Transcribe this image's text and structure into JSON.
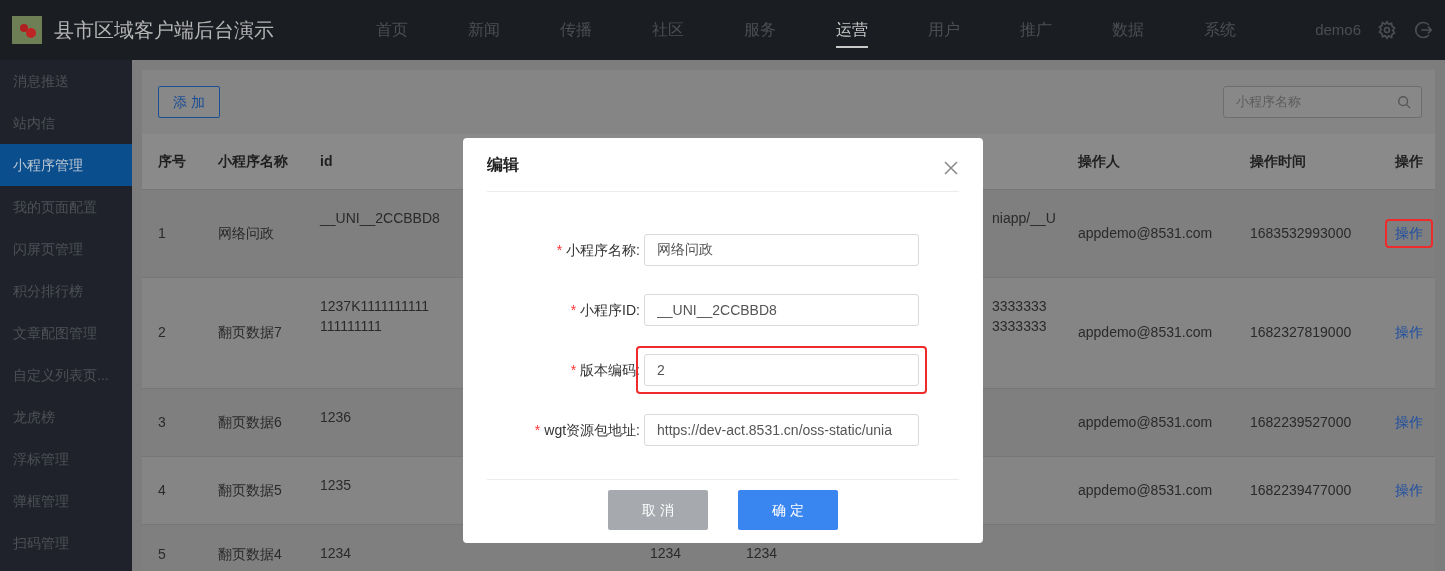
{
  "header": {
    "title": "县市区域客户端后台演示",
    "nav": [
      {
        "label": "首页",
        "selected": false
      },
      {
        "label": "新闻",
        "selected": false
      },
      {
        "label": "传播",
        "selected": false
      },
      {
        "label": "社区",
        "selected": false
      },
      {
        "label": "服务",
        "selected": false
      },
      {
        "label": "运营",
        "selected": true
      },
      {
        "label": "用户",
        "selected": false
      },
      {
        "label": "推广",
        "selected": false
      },
      {
        "label": "数据",
        "selected": false
      },
      {
        "label": "系统",
        "selected": false
      }
    ],
    "user": "demo6"
  },
  "sidebar": {
    "items": [
      {
        "label": "消息推送",
        "selected": false
      },
      {
        "label": "站内信",
        "selected": false
      },
      {
        "label": "小程序管理",
        "selected": true
      },
      {
        "label": "我的页面配置",
        "selected": false
      },
      {
        "label": "闪屏页管理",
        "selected": false
      },
      {
        "label": "积分排行榜",
        "selected": false
      },
      {
        "label": "文章配图管理",
        "selected": false
      },
      {
        "label": "自定义列表页...",
        "selected": false
      },
      {
        "label": "龙虎榜",
        "selected": false
      },
      {
        "label": "浮标管理",
        "selected": false
      },
      {
        "label": "弹框管理",
        "selected": false
      },
      {
        "label": "扫码管理",
        "selected": false
      }
    ]
  },
  "toolbar": {
    "add_button": "添 加",
    "search": {
      "placeholder": "小程序名称"
    }
  },
  "table": {
    "columns": {
      "seq": "序号",
      "name": "小程序名称",
      "id": "id",
      "operator": "操作人",
      "time": "操作时间",
      "action": "操作"
    },
    "rows": [
      {
        "seq": "1",
        "name": "网络问政",
        "id": "__UNI__2CCBBD8",
        "column_5": "niapp/__U",
        "operator": "appdemo@8531.com",
        "time": "1683532993000",
        "action": "操作",
        "highlighted": true
      },
      {
        "seq": "2",
        "name": "翻页数据7",
        "id": "1237K1111111111\n111111111",
        "column_5": "3333333\n3333333",
        "operator": "appdemo@8531.com",
        "time": "1682327819000",
        "action": "操作",
        "highlighted": false
      },
      {
        "seq": "3",
        "name": "翻页数据6",
        "id": "1236",
        "operator": "appdemo@8531.com",
        "time": "1682239527000",
        "action": "操作",
        "highlighted": false
      },
      {
        "seq": "4",
        "name": "翻页数据5",
        "id": "1235",
        "operator": "appdemo@8531.com",
        "time": "1682239477000",
        "action": "操作",
        "highlighted": false
      },
      {
        "seq": "5",
        "name": "翻页数据4",
        "id": "1234",
        "column_4": "1234",
        "column_5": "1234"
      }
    ]
  },
  "modal": {
    "title": "编辑",
    "fields": [
      {
        "label": "小程序名称:",
        "required_mark": "*",
        "value": "网络问政",
        "highlighted": false
      },
      {
        "label": "小程序ID:",
        "required_mark": "*",
        "value": "__UNI__2CCBBD8",
        "highlighted": false
      },
      {
        "label": "版本编码:",
        "required_mark": "*",
        "value": "2",
        "highlighted": true
      },
      {
        "label": "wgt资源包地址:",
        "required_mark": "*",
        "value": "https://dev-act.8531.cn/oss-static/unia",
        "highlighted": false
      }
    ],
    "buttons": [
      {
        "label": "取 消",
        "kind": "cancel"
      },
      {
        "label": "确 定",
        "kind": "primary"
      }
    ]
  }
}
